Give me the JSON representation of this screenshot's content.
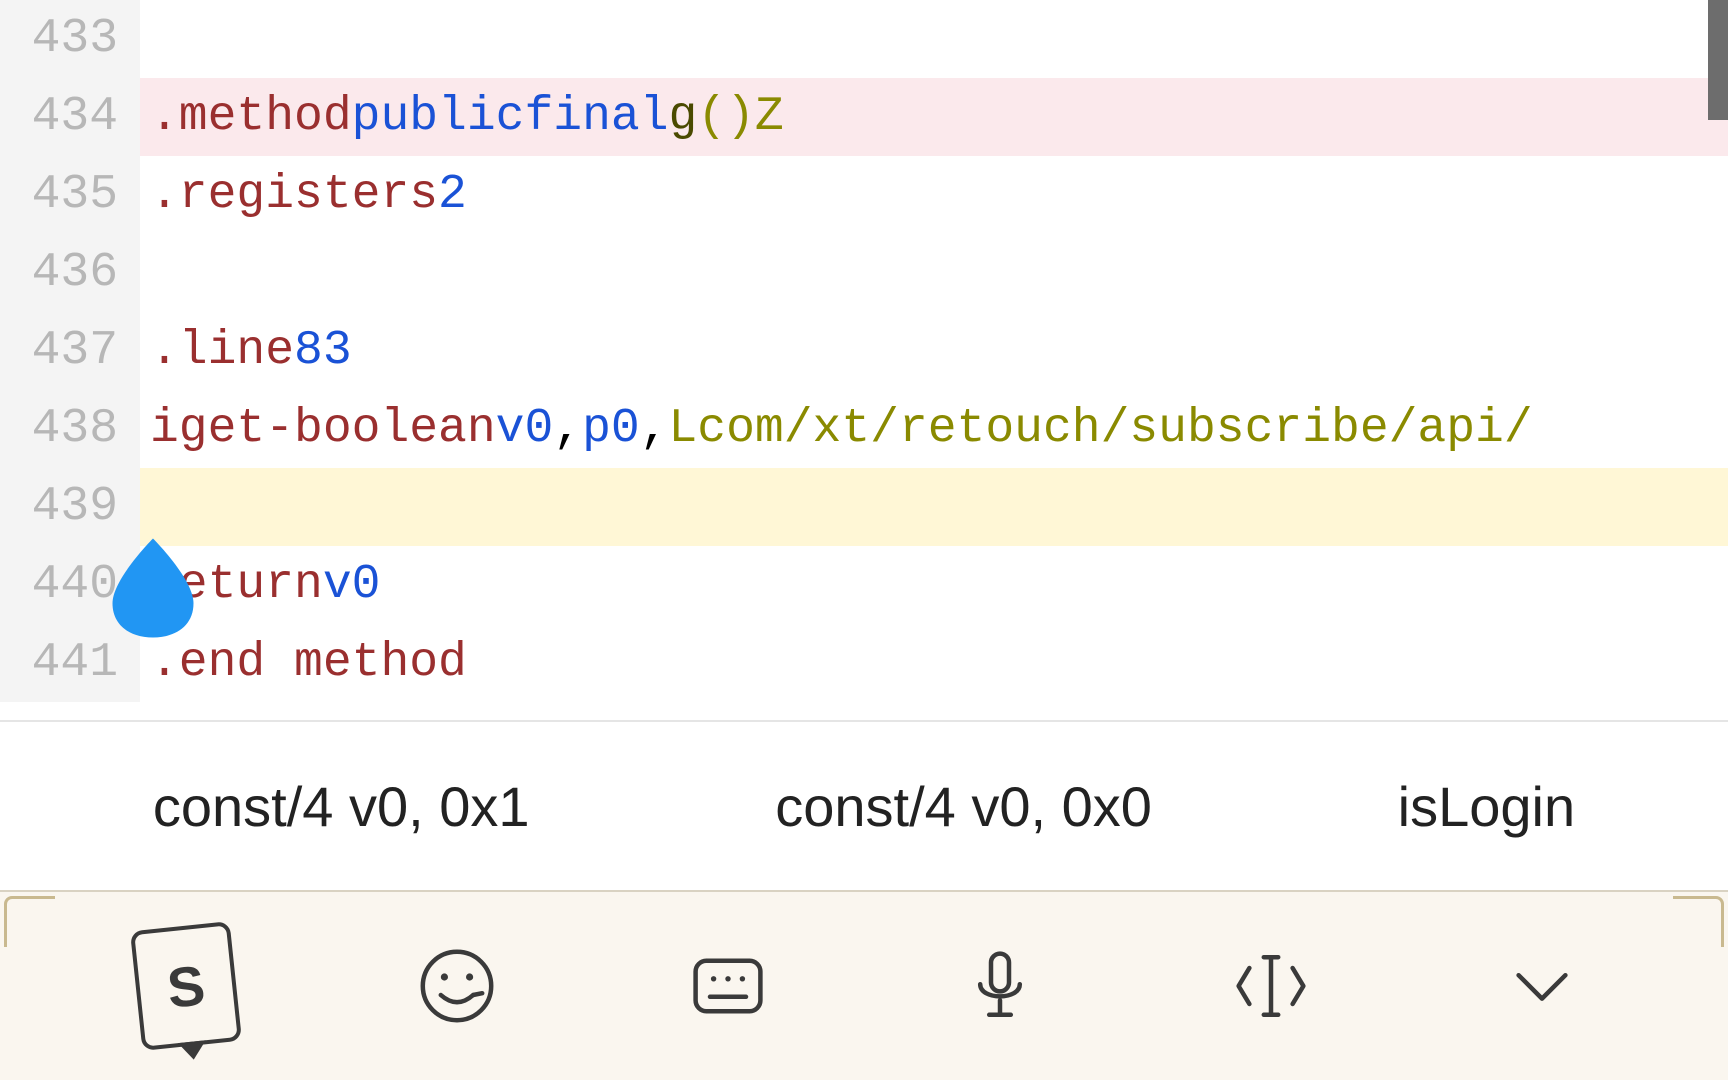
{
  "editor": {
    "cursor_line": 439,
    "lines": [
      {
        "num": 433,
        "indent": 0,
        "tokens": []
      },
      {
        "num": 434,
        "indent": 0,
        "highlight": "pink",
        "tokens": [
          {
            "t": ".method",
            "c": "dir"
          },
          {
            "t": " "
          },
          {
            "t": "public",
            "c": "kw"
          },
          {
            "t": " "
          },
          {
            "t": "final",
            "c": "kw"
          },
          {
            "t": " "
          },
          {
            "t": "g",
            "c": "name"
          },
          {
            "t": "()Z",
            "c": "sig"
          }
        ]
      },
      {
        "num": 435,
        "indent": 1,
        "tokens": [
          {
            "t": ".registers",
            "c": "dir"
          },
          {
            "t": " "
          },
          {
            "t": "2",
            "c": "num"
          }
        ]
      },
      {
        "num": 436,
        "indent": 0,
        "tokens": []
      },
      {
        "num": 437,
        "indent": 1,
        "tokens": [
          {
            "t": ".line",
            "c": "dir"
          },
          {
            "t": " "
          },
          {
            "t": "83",
            "c": "num"
          }
        ]
      },
      {
        "num": 438,
        "indent": 1,
        "tokens": [
          {
            "t": "iget-boolean",
            "c": "dir"
          },
          {
            "t": " "
          },
          {
            "t": "v0",
            "c": "reg"
          },
          {
            "t": ",",
            "c": "punc"
          },
          {
            "t": " "
          },
          {
            "t": "p0",
            "c": "reg"
          },
          {
            "t": ",",
            "c": "punc"
          },
          {
            "t": " "
          },
          {
            "t": "Lcom/xt/retouch/subscribe/api/",
            "c": "class"
          }
        ]
      },
      {
        "num": 439,
        "indent": 0,
        "highlight": "yellow",
        "tokens": []
      },
      {
        "num": 440,
        "indent": 1,
        "tokens": [
          {
            "t": "return",
            "c": "dir"
          },
          {
            "t": " "
          },
          {
            "t": "v0",
            "c": "reg"
          }
        ]
      },
      {
        "num": 441,
        "indent": 0,
        "tokens": [
          {
            "t": ".end method",
            "c": "dir"
          }
        ]
      }
    ]
  },
  "suggestions": [
    "const/4 v0, 0x1",
    "const/4 v0, 0x0",
    "isLogin"
  ],
  "ime_icons": [
    "sogou-logo",
    "emoji-icon",
    "keyboard-icon",
    "mic-icon",
    "cursor-move-icon",
    "chevron-down-icon"
  ],
  "colors": {
    "gutter_bg": "#f4f4f4",
    "gutter_fg": "#b7b7b7",
    "hl_pink": "#fbe9ec",
    "hl_yellow": "#fff7d6",
    "handle": "#2196f3",
    "ime_bg": "#faf6ef"
  }
}
